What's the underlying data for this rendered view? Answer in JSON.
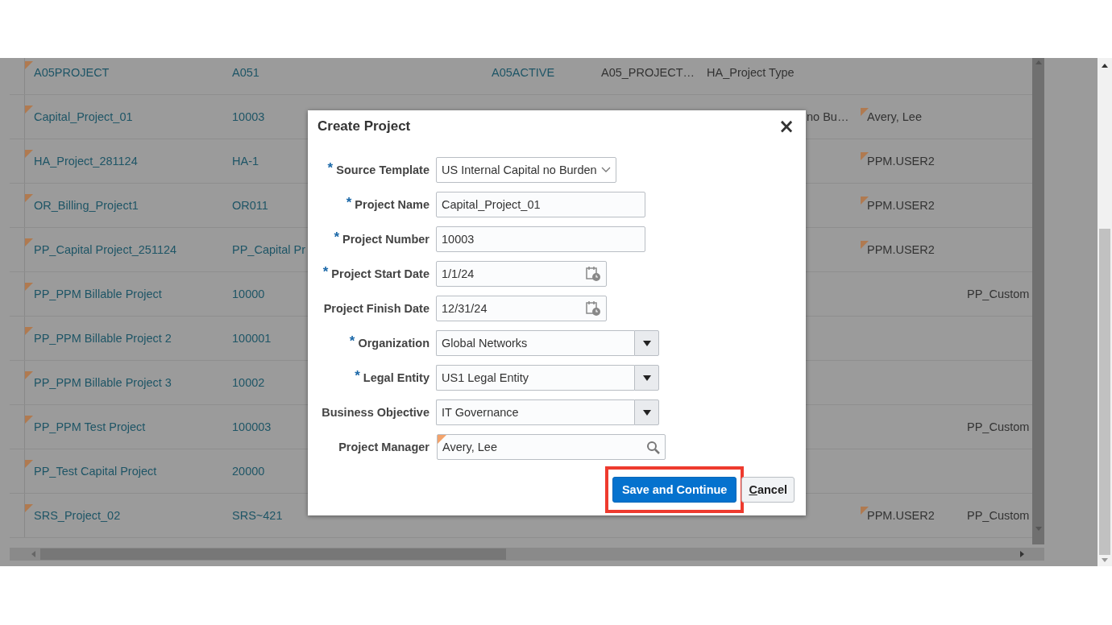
{
  "table": {
    "rows": [
      {
        "name": "A05PROJECT",
        "name_flagged": true,
        "number": "A051",
        "status": "A05ACTIVE",
        "unit": "A05_PROJECT…",
        "type": "HA_Project Type"
      },
      {
        "name": "Capital_Project_01",
        "name_flagged": true,
        "number": "10003",
        "column_6": "no Bu…",
        "manager": "Avery, Lee",
        "manager_flagged": true
      },
      {
        "name": "HA_Project_281124",
        "name_flagged": true,
        "number": "HA-1",
        "manager": "PPM.USER2",
        "manager_flagged": true
      },
      {
        "name": "OR_Billing_Project1",
        "name_flagged": true,
        "number": "OR011",
        "manager": "PPM.USER2",
        "manager_flagged": true
      },
      {
        "name": "PP_Capital Project_251124",
        "name_flagged": true,
        "number": "PP_Capital Pr",
        "manager": "PPM.USER2",
        "manager_flagged": true
      },
      {
        "name": "PP_PPM Billable Project",
        "name_flagged": true,
        "number": "10000",
        "customer": "PP_Custom"
      },
      {
        "name": "PP_PPM Billable Project 2",
        "name_flagged": true,
        "number": "100001"
      },
      {
        "name": "PP_PPM Billable Project 3",
        "name_flagged": true,
        "number": "10002"
      },
      {
        "name": "PP_PPM Test Project",
        "name_flagged": true,
        "number": "100003",
        "customer": "PP_Custom"
      },
      {
        "name": "PP_Test Capital Project",
        "name_flagged": true,
        "number": "20000"
      },
      {
        "name": "SRS_Project_02",
        "name_flagged": true,
        "number": "SRS~421",
        "manager": "PPM.USER2",
        "manager_flagged": true,
        "customer": "PP_Custom"
      }
    ]
  },
  "dialog": {
    "title": "Create Project",
    "close": "×",
    "fields": [
      {
        "label": "Source Template",
        "required_mark": "*",
        "kind": "select",
        "value": "US Internal Capital no Burden"
      },
      {
        "label": "Project Name",
        "required_mark": "*",
        "kind": "text",
        "value": "Capital_Project_01"
      },
      {
        "label": "Project Number",
        "required_mark": "*",
        "kind": "text",
        "value": "10003"
      },
      {
        "label": "Project Start Date",
        "required_mark": "*",
        "kind": "date",
        "value": "1/1/24"
      },
      {
        "label": "Project Finish Date",
        "kind": "date",
        "value": "12/31/24"
      },
      {
        "label": "Organization",
        "required_mark": "*",
        "kind": "choice",
        "value": "Global Networks"
      },
      {
        "label": "Legal Entity",
        "required_mark": "*",
        "kind": "choice",
        "value": "US1 Legal Entity"
      },
      {
        "label": "Business Objective",
        "kind": "choice",
        "value": "IT Governance"
      },
      {
        "label": "Project Manager",
        "kind": "lookup",
        "value": "Avery, Lee",
        "flagged": true
      }
    ],
    "buttons": [
      {
        "label": "Save and Continue",
        "kind": "primary",
        "highlighted": true,
        "access_key_underlined": false
      },
      {
        "label": "Cancel",
        "kind": "secondary",
        "highlighted": false,
        "access_key_underlined": true
      }
    ]
  }
}
